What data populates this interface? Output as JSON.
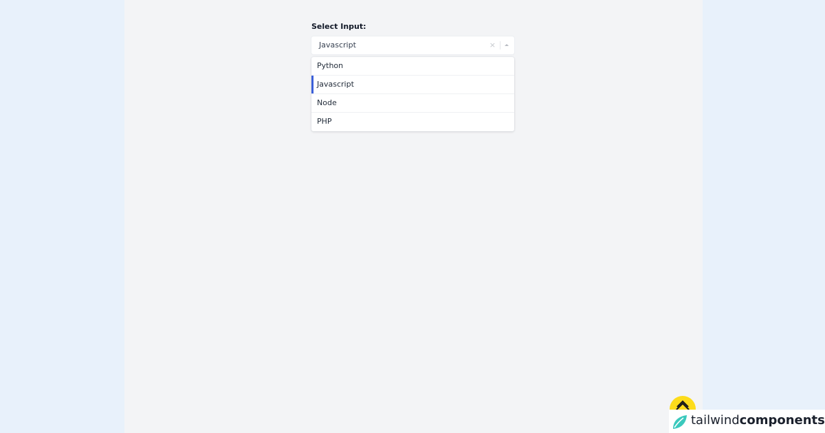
{
  "form": {
    "label": "Select Input:",
    "selected_value": "Javascript",
    "clear_symbol": "×",
    "options": [
      "Python",
      "Javascript",
      "Node",
      "PHP"
    ],
    "active_option": "Javascript"
  },
  "brand": {
    "light_text": "tailwind",
    "bold_text": "components"
  },
  "colors": {
    "accent": "#3b5fd9",
    "brand_teal": "#3bc9bd",
    "coffee_yellow": "#fddc1b"
  }
}
